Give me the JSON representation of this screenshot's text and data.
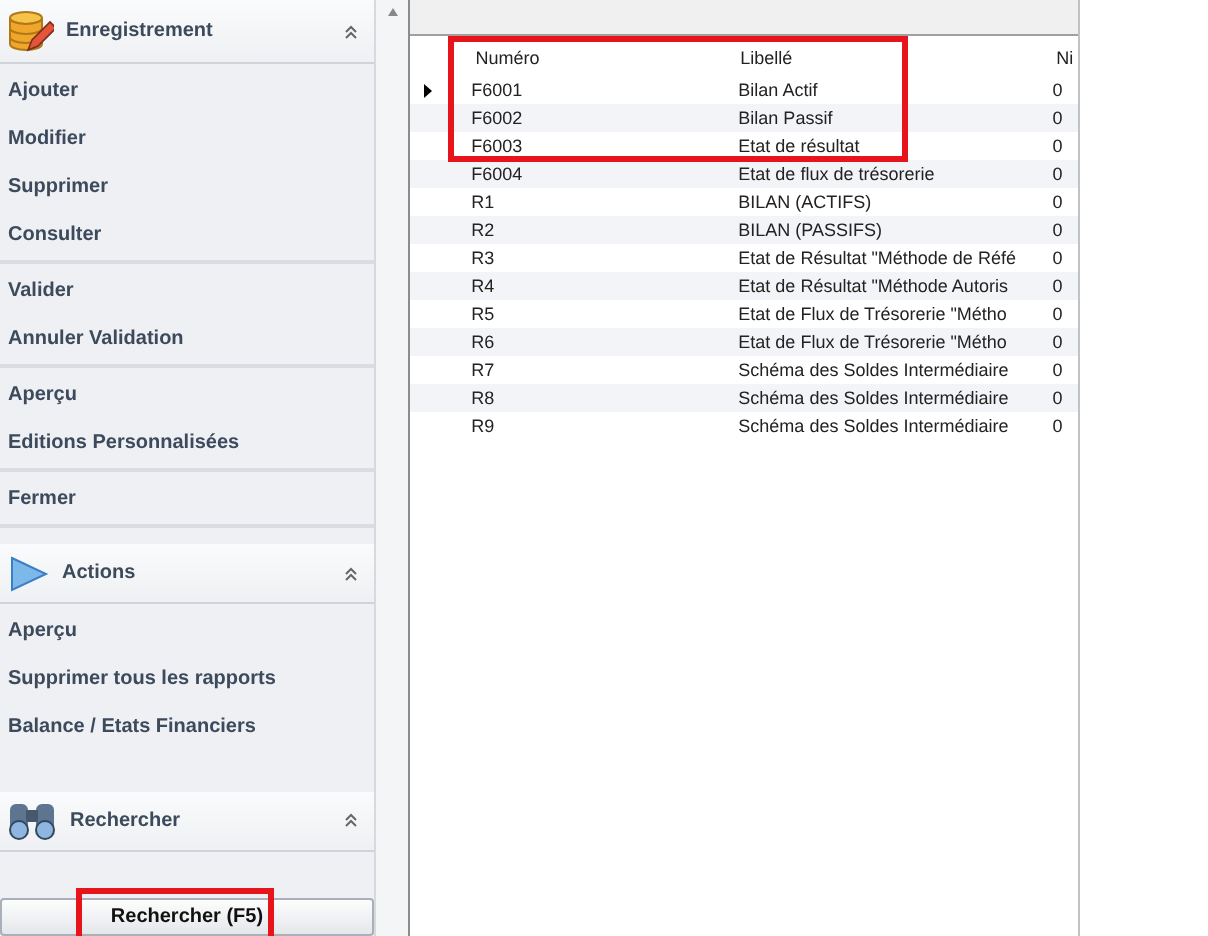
{
  "sidebar": {
    "sections": [
      {
        "kind": "records",
        "title": "Enregistrement",
        "expanded": true,
        "groups": [
          [
            "Ajouter",
            "Modifier",
            "Supprimer",
            "Consulter"
          ],
          [
            "Valider",
            "Annuler Validation"
          ],
          [
            "Aperçu",
            "Editions Personnalisées"
          ],
          [
            "Fermer"
          ]
        ]
      },
      {
        "kind": "actions",
        "title": "Actions",
        "expanded": true,
        "groups": [
          [
            "Aperçu",
            "Supprimer tous les rapports",
            "Balance / Etats Financiers"
          ]
        ]
      },
      {
        "kind": "search",
        "title": "Rechercher",
        "expanded": true
      }
    ],
    "search_button": {
      "label": "Rechercher (F5)",
      "framed": true
    }
  },
  "table": {
    "columns": [
      "Numéro",
      "Libellé",
      "Ni"
    ],
    "header_framed": true,
    "rows": [
      {
        "numero": "F6001",
        "libelle": "Bilan Actif",
        "column_3": "0",
        "current": true,
        "framed": true
      },
      {
        "numero": "F6002",
        "libelle": "Bilan Passif",
        "column_3": "0",
        "current": false,
        "framed": true
      },
      {
        "numero": "F6003",
        "libelle": "Etat de résultat",
        "column_3": "0",
        "current": false,
        "framed": true
      },
      {
        "numero": "F6004",
        "libelle": "Etat de flux de trésorerie",
        "column_3": "0",
        "current": false,
        "framed": false
      },
      {
        "numero": "R1",
        "libelle": "BILAN (ACTIFS)",
        "column_3": "0",
        "current": false,
        "framed": false
      },
      {
        "numero": "R2",
        "libelle": "BILAN (PASSIFS)",
        "column_3": "0",
        "current": false,
        "framed": false
      },
      {
        "numero": "R3",
        "libelle": "Etat de Résultat \"Méthode de Réfé",
        "column_3": "0",
        "current": false,
        "framed": false
      },
      {
        "numero": "R4",
        "libelle": "Etat de Résultat \"Méthode Autoris",
        "column_3": "0",
        "current": false,
        "framed": false
      },
      {
        "numero": "R5",
        "libelle": "Etat de Flux de Trésorerie \"Métho",
        "column_3": "0",
        "current": false,
        "framed": false
      },
      {
        "numero": "R6",
        "libelle": "Etat de Flux de Trésorerie \"Métho",
        "column_3": "0",
        "current": false,
        "framed": false
      },
      {
        "numero": "R7",
        "libelle": "Schéma des Soldes Intermédiaire",
        "column_3": "0",
        "current": false,
        "framed": false
      },
      {
        "numero": "R8",
        "libelle": "Schéma des Soldes Intermédiaire",
        "column_3": "0",
        "current": false,
        "framed": false
      },
      {
        "numero": "R9",
        "libelle": "Schéma des Soldes Intermédiaire",
        "column_3": "0",
        "current": false,
        "framed": false
      }
    ]
  }
}
